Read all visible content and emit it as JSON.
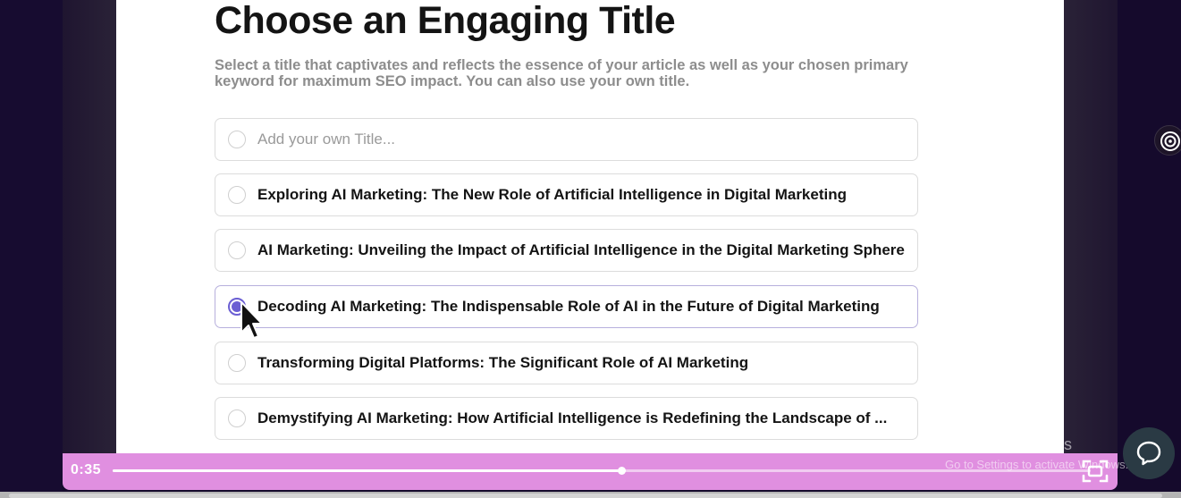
{
  "page": {
    "title": "Choose an Engaging Title",
    "subtitle": "Select a title that captivates and reflects the essence of your article as well as your chosen primary keyword for maximum SEO impact. You can also use your own title."
  },
  "custom_title": {
    "placeholder": "Add your own Title...",
    "value": ""
  },
  "options": [
    {
      "label": "Exploring AI Marketing: The New Role of Artificial Intelligence in Digital Marketing",
      "selected": false
    },
    {
      "label": "AI Marketing: Unveiling the Impact of Artificial Intelligence in the Digital Marketing Sphere",
      "selected": false
    },
    {
      "label": "Decoding AI Marketing: The Indispensable Role of AI in the Future of Digital Marketing",
      "selected": true
    },
    {
      "label": "Transforming Digital Platforms: The Significant Role of AI Marketing",
      "selected": false
    },
    {
      "label": "Demystifying AI Marketing: How Artificial Intelligence is Redefining the Landscape of ...",
      "selected": false
    }
  ],
  "video_player": {
    "current_time": "0:35",
    "progress_percent": 52
  },
  "watermark": {
    "line1": "Activate Windows",
    "line2": "Go to Settings to activate Windows."
  },
  "icons": {
    "side": "target-icon",
    "chat": "chat-bubble-icon",
    "fullscreen": "fullscreen-icon",
    "cursor": "mouse-pointer-icon"
  },
  "colors": {
    "accent": "#6b5fd3",
    "player_bar": "#e08fe0",
    "background": "#150a2c"
  }
}
